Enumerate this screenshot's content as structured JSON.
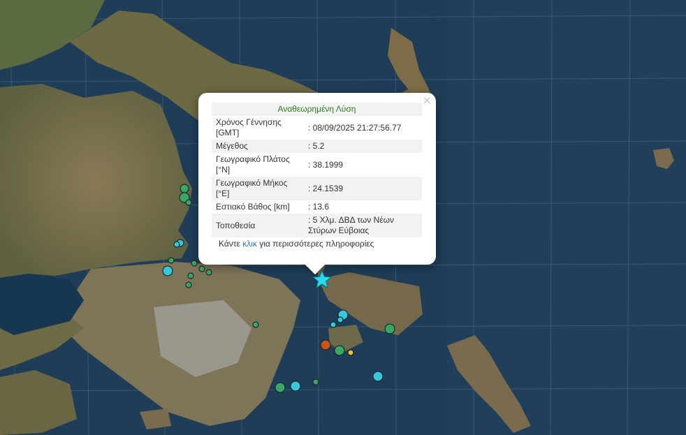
{
  "popup": {
    "title": "Αναθεωρημένη Λύση",
    "close_symbol": "×",
    "rows": [
      {
        "label": "Χρόνος Γέννησης [GMT]",
        "value": ": 08/09/2025 21:27:56.77"
      },
      {
        "label": "Μέγεθος",
        "value": ": 5.2"
      },
      {
        "label": "Γεωγραφικό Πλάτος [°N]",
        "value": ": 38.1999"
      },
      {
        "label": "Γεωγραφικό Μήκος [°E]",
        "value": ": 24.1539"
      },
      {
        "label": "Εστιακό Βάθος [km]",
        "value": ": 13.6"
      },
      {
        "label": "Τοποθεσία",
        "value": ": 5 Χλμ. ΔΒΔ των Νέων Στύρων Εύβοιας"
      }
    ],
    "more_prefix": "Κάντε ",
    "more_link": "κλικ",
    "more_suffix": " για περισσότερες πληροφορίες"
  },
  "colors": {
    "sea": "#1c3a52",
    "land": "#7a6a48",
    "urban": "#9a9a92",
    "epicenter_star": "#29d9ee",
    "marker_cyan": "#39c7dc",
    "marker_green": "#3aa864",
    "marker_orange": "#c8541c",
    "marker_yellow": "#e5c52a",
    "popup_title": "#2e7d1e",
    "link": "#2a7bc0"
  }
}
